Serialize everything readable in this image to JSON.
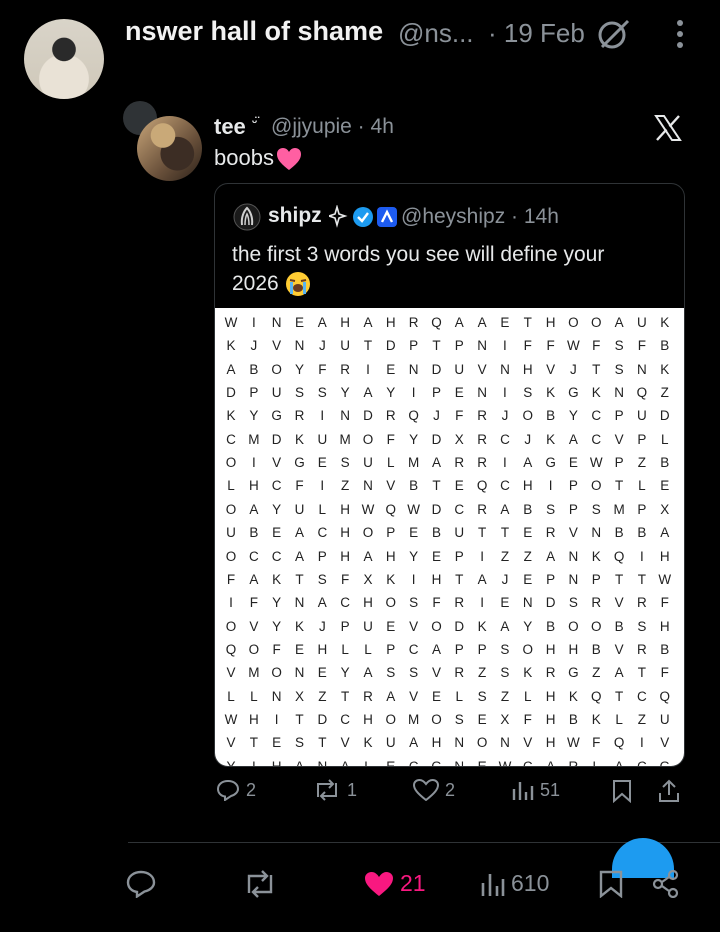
{
  "post": {
    "author_name": "nswer hall of shame",
    "author_handle": "@ns...",
    "date": "· 19 Feb"
  },
  "embed": {
    "user_name": "tee",
    "user_handle": "@jjyupie · 4h",
    "text": "boobs",
    "quote": {
      "user_name": "shipz",
      "user_handle": "@heyshipz · 14h",
      "text": "the first 3 words you see will define your 2026",
      "grid_rows": [
        "WINEAHAHRQAAETHOOAUK",
        "KJVNJUTDPTPNIFFWFSFB",
        "ABOYFRIENDUVNHVJTSNK",
        "DPUSSYAYIPENISKGKNQZ",
        "KYGRINDRQJFRJOBYCPUD",
        "CMDKUMOFYDXRCJKACVPL",
        "OIVGESULMARRIAGEWPZB",
        "LHCFIZNVBTEQCHIPOTLE",
        "OAYULHWQWDCRABSPSMPX",
        "UBEACHOPEBUTTERVNBBA",
        "OCCAPHAHYEPIZZANKQIH",
        "FAKTSFXKIHTAJEPNPTTW",
        "IFYNACHOSFRIENDSRVRF",
        "OVYKJPUEVODKAYBOOBSH",
        "QOFEHLLPCAPPSOHHBVRB",
        "VMONEYASSVRZSKRGZATF",
        "LLNXZTRAVELSZLHKQTCQ",
        "WHITDCHOMOSEXFHBKLZU",
        "VTESTVKUAHNONVHWFQIV",
        "YIHANALECGNEWCARLACG"
      ],
      "actions": {
        "replies": "2",
        "reposts": "1",
        "likes": "2",
        "views": "51"
      }
    }
  },
  "actions": {
    "likes": "21",
    "views": "610"
  },
  "colors": {
    "like_active": "#f91880",
    "verified": "#1d9bf0",
    "muted": "#8b9299"
  }
}
